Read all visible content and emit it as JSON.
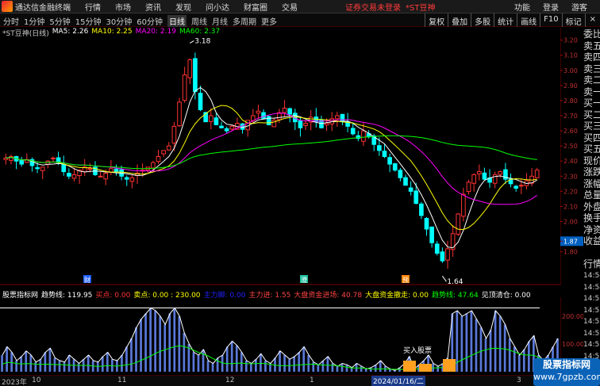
{
  "menubar": {
    "app_title": "通达信金融终端",
    "items": [
      "行情",
      "市场",
      "资讯",
      "发现",
      "问小达",
      "财富圈",
      "交易"
    ],
    "notice": "证券交易未登录",
    "stock_tag": "*ST豆神",
    "right_items": [
      "功能",
      "登录",
      "游客"
    ],
    "window_buttons": [
      "–",
      "□",
      "×"
    ]
  },
  "toolbar": {
    "periods": [
      "分时",
      "1分钟",
      "5分钟",
      "15分钟",
      "30分钟",
      "60分钟",
      "日线",
      "周线",
      "月线",
      "多周期",
      "更多"
    ],
    "active_period": "日线",
    "tools": [
      "复权",
      "叠加",
      "多股",
      "统计",
      "画线",
      "F10",
      "标记"
    ],
    "close_icon": "×"
  },
  "main_legend": {
    "stock": "*ST豆神(日线)",
    "ma5": "MA5: 2.26",
    "ma10": "MA10: 2.25",
    "ma20": "MA20: 2.19",
    "ma60": "MA60: 2.37",
    "colors": {
      "ma5": "#ffffff",
      "ma10": "#ffff00",
      "ma20": "#ff00ff",
      "ma60": "#00ff00"
    }
  },
  "chart_data": {
    "type": "candlestick",
    "y_ticks": [
      "3.20",
      "3.10",
      "3.00",
      "2.90",
      "2.80",
      "2.70",
      "2.60",
      "2.50",
      "2.40",
      "2.30",
      "2.20",
      "2.10",
      "2.00",
      "1.87",
      "1.80"
    ],
    "ylim": [
      1.62,
      3.24
    ],
    "annotations": [
      {
        "label": "3.18",
        "value": 3.18
      },
      {
        "label": "1.64",
        "value": 1.64
      }
    ],
    "current_price": "1.87",
    "closes": [
      2.42,
      2.43,
      2.4,
      2.38,
      2.41,
      2.37,
      2.35,
      2.36,
      2.4,
      2.42,
      2.39,
      2.33,
      2.3,
      2.31,
      2.34,
      2.36,
      2.35,
      2.31,
      2.3,
      2.32,
      2.35,
      2.33,
      2.3,
      2.28,
      2.29,
      2.32,
      2.34,
      2.36,
      2.39,
      2.43,
      2.47,
      2.5,
      2.63,
      2.79,
      2.97,
      3.07,
      2.86,
      2.74,
      2.66,
      2.7,
      2.64,
      2.62,
      2.6,
      2.63,
      2.65,
      2.61,
      2.67,
      2.7,
      2.73,
      2.68,
      2.64,
      2.67,
      2.72,
      2.75,
      2.71,
      2.66,
      2.62,
      2.65,
      2.69,
      2.66,
      2.62,
      2.65,
      2.68,
      2.7,
      2.66,
      2.63,
      2.58,
      2.55,
      2.6,
      2.56,
      2.51,
      2.47,
      2.43,
      2.38,
      2.34,
      2.29,
      2.24,
      2.2,
      2.12,
      2.04,
      1.95,
      1.86,
      1.79,
      1.74,
      1.82,
      1.92,
      2.05,
      2.18,
      2.26,
      2.31,
      2.33,
      2.28,
      2.26,
      2.31,
      2.33,
      2.28,
      2.25,
      2.22,
      2.24,
      2.27,
      2.3,
      2.34
    ],
    "annotation_tags": [
      "财",
      "澄",
      "预"
    ]
  },
  "indicator": {
    "name": "股票指标网",
    "values": [
      {
        "text": "趋势线: 119.95",
        "color": "#ffffff"
      },
      {
        "text": "买点: 0.00",
        "color": "#ff3333"
      },
      {
        "text": "卖点: 0.00 : 230.00",
        "color": "#ffff00"
      },
      {
        "text": "主力脚: 0.00",
        "color": "#2222ff"
      },
      {
        "text": "主力进: 1.55",
        "color": "#ff4444"
      },
      {
        "text": "大盘资金进场: 40.78",
        "color": "#ff4444"
      },
      {
        "text": "大盘资金撤走: 0.00",
        "color": "#ffff00"
      },
      {
        "text": "趋势线: 47.64",
        "color": "#00ff00"
      },
      {
        "text": "见顶清仓: 0.00",
        "color": "#ffffff"
      }
    ],
    "y_ticks": [
      "200.00",
      "100.00"
    ],
    "marker": "买入股票",
    "bars": [
      60,
      90,
      70,
      40,
      55,
      75,
      60,
      35,
      45,
      70,
      85,
      50,
      40,
      35,
      60,
      45,
      30,
      45,
      60,
      40,
      35,
      55,
      70,
      45,
      40,
      60,
      90,
      120,
      160,
      190,
      210,
      230,
      220,
      200,
      170,
      210,
      230,
      200,
      140,
      100,
      70,
      60,
      80,
      40,
      30,
      50,
      60,
      90,
      110,
      95,
      70,
      40,
      30,
      45,
      65,
      40,
      30,
      50,
      75,
      60,
      45,
      55,
      70,
      90,
      60,
      35,
      25,
      40,
      55,
      30,
      20,
      30,
      25,
      15,
      30,
      20,
      10,
      15,
      25,
      40,
      20,
      10,
      5,
      15,
      30,
      55,
      10,
      25,
      40,
      60,
      30,
      20,
      30,
      50,
      210,
      220,
      200,
      210,
      220,
      190,
      160,
      120,
      150,
      220,
      200,
      170,
      120,
      90,
      60,
      80,
      110,
      130,
      60,
      40,
      60,
      90,
      120
    ]
  },
  "side_panel": {
    "labels": [
      "委比",
      "卖五",
      "卖四",
      "卖三",
      "卖二",
      "卖一",
      "买一",
      "买二",
      "买三",
      "买四",
      "买五",
      "现价",
      "涨跌",
      "涨幅",
      "总量",
      "外盘",
      "换手",
      "净资",
      "收益",
      "",
      "行情"
    ],
    "status_values": [
      "14:54",
      "14:54",
      "14:55",
      "14:55",
      "14:55",
      "14:55",
      "14:55",
      "14:55",
      "14:55"
    ]
  },
  "datebar": {
    "labels": [
      {
        "text": "2023年",
        "pos": 2
      },
      {
        "text": "10",
        "pos": 40
      },
      {
        "text": "11",
        "pos": 148
      },
      {
        "text": "12",
        "pos": 284
      },
      {
        "text": "1",
        "pos": 390
      },
      {
        "text": "3",
        "pos": 651
      }
    ],
    "current": "2024/01/16/二"
  },
  "watermark": {
    "title": "股票指标网",
    "url": "www.7gpzb.com"
  }
}
